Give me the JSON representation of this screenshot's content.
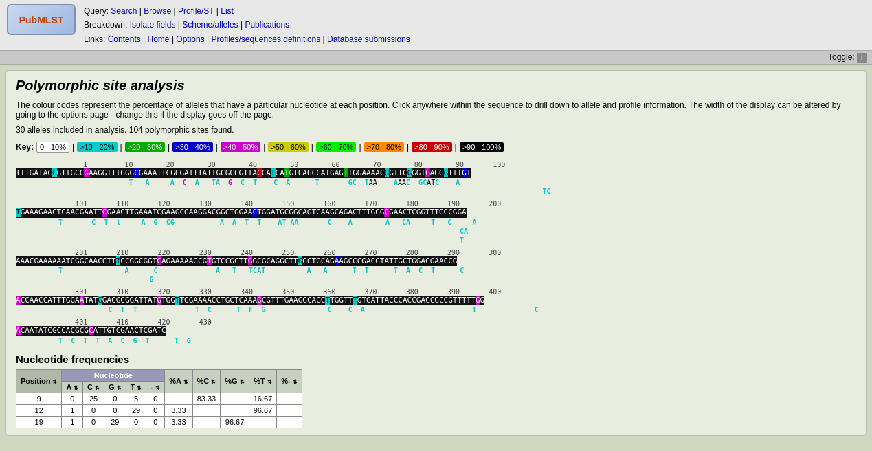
{
  "header": {
    "logo_text": "PubMLST",
    "query_label": "Query:",
    "query_links": [
      "Search",
      "Browse",
      "Profile/ST",
      "List"
    ],
    "breakdown_label": "Breakdown:",
    "breakdown_links": [
      "Isolate fields",
      "Scheme/alleles",
      "Publications"
    ],
    "links_label": "Links:",
    "links_links": [
      "Contents",
      "Home",
      "Options",
      "Profiles/sequences definitions",
      "Database submissions"
    ],
    "toggle_label": "Toggle:",
    "toggle_icon": "i"
  },
  "page": {
    "title": "Polymorphic site analysis",
    "description": "The colour codes represent the percentage of alleles that have a particular nucleotide at each position. Click anywhere within the sequence to drill down to allele and profile information. The width of the display can be altered by going to the options page - change this if the display goes off the page.",
    "summary": "30 alleles included in analysis. 104 polymorphic sites found."
  },
  "key": {
    "label": "Key:",
    "items": [
      {
        "label": "0 - 10%",
        "bg": "#ffffff",
        "color": "#000000",
        "border": "#000"
      },
      {
        "label": ">10 - 20%",
        "bg": "#00cccc",
        "color": "#000000"
      },
      {
        "label": ">20 - 30%",
        "bg": "#00aa00",
        "color": "#ffffff"
      },
      {
        "label": ">30 - 40%",
        "bg": "#0000cc",
        "color": "#ffffff"
      },
      {
        "label": ">40 - 50%",
        "bg": "#cc00cc",
        "color": "#ffffff"
      },
      {
        "label": ">50 - 60%",
        "bg": "#cccc00",
        "color": "#000000"
      },
      {
        "label": ">60 - 70%",
        "bg": "#00ff00",
        "color": "#000000"
      },
      {
        "label": ">70 - 80%",
        "bg": "#ff8800",
        "color": "#000000"
      },
      {
        "label": ">80 - 90%",
        "bg": "#cc0000",
        "color": "#ffffff"
      },
      {
        "label": ">90 - 100%",
        "bg": "#000000",
        "color": "#ffffff"
      }
    ]
  },
  "nucleotide_table": {
    "title": "Nucleotide frequencies",
    "headers": [
      "Position",
      "A",
      "C",
      "G",
      "T",
      "-",
      "%A",
      "%C",
      "%G",
      "%T",
      "%-"
    ],
    "rows": [
      [
        9,
        0,
        25,
        0,
        5,
        0,
        "",
        "83.33",
        "",
        "16.67",
        ""
      ],
      [
        12,
        1,
        0,
        0,
        29,
        0,
        "3.33",
        "",
        "",
        "96.67",
        ""
      ],
      [
        19,
        1,
        0,
        29,
        0,
        0,
        "3.33",
        "",
        "96.67",
        "",
        ""
      ]
    ]
  }
}
